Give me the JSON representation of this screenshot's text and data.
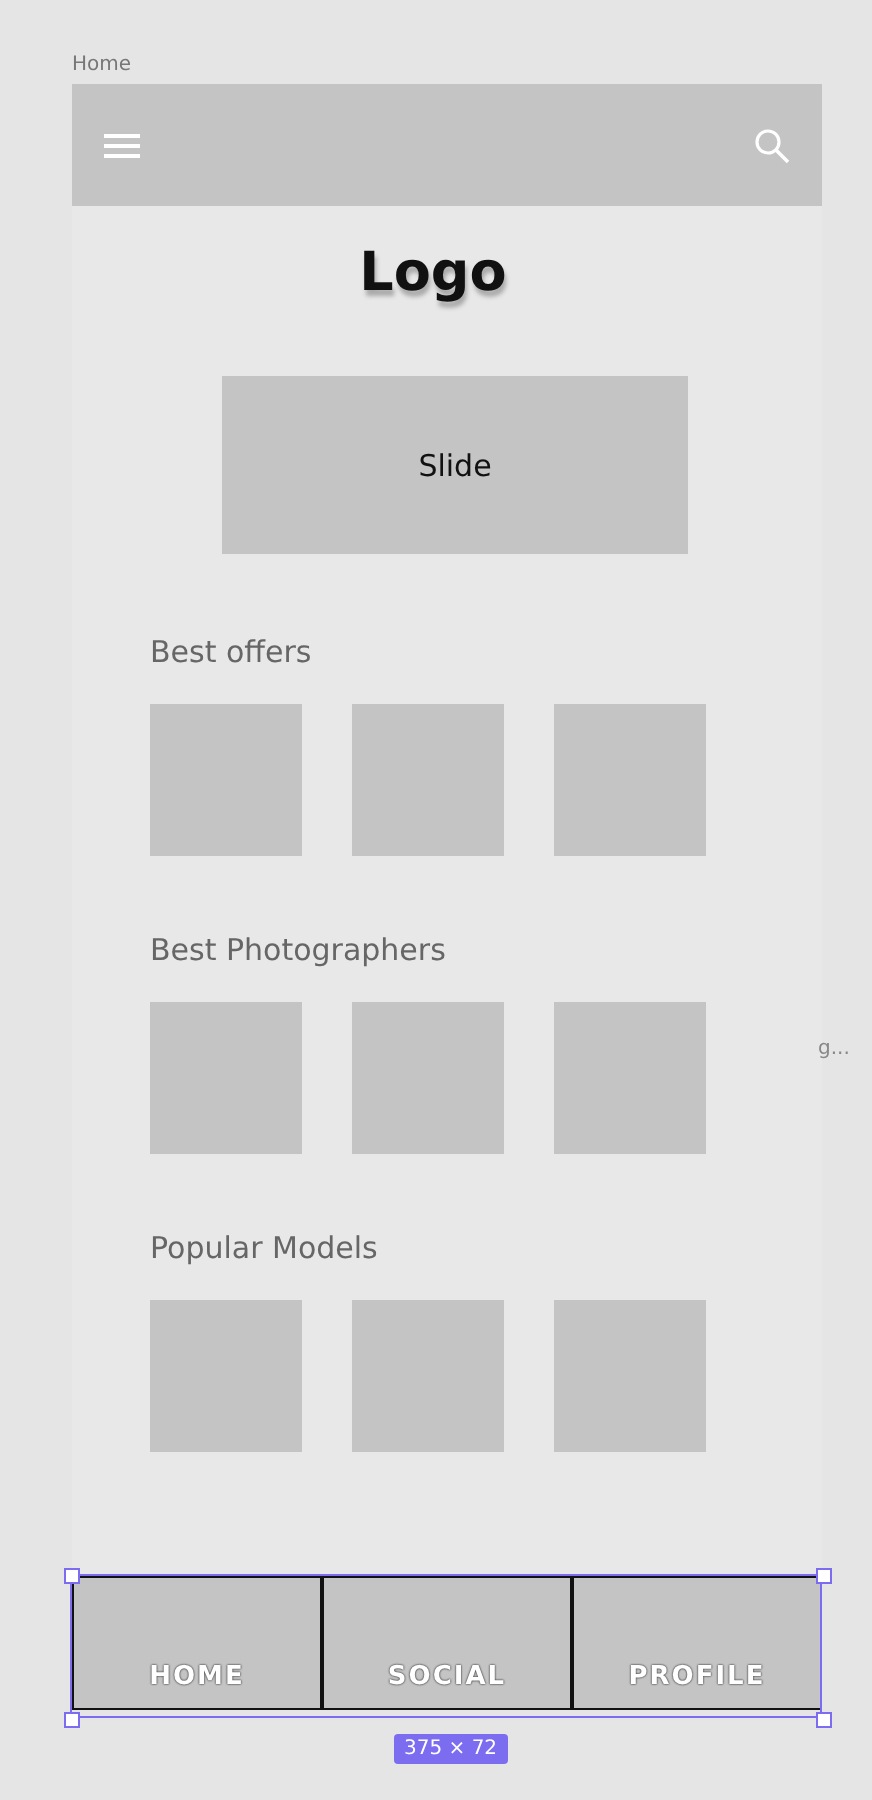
{
  "frame_label": "Home",
  "side_label": "g...",
  "logo": "Logo",
  "slide": "Slide",
  "sections": [
    {
      "title": "Best offers"
    },
    {
      "title": "Best Photographers"
    },
    {
      "title": "Popular Models"
    }
  ],
  "tab_bar": {
    "tabs": [
      {
        "label": "HOME"
      },
      {
        "label": "SOCIAL"
      },
      {
        "label": "PROFILE"
      }
    ],
    "size": "375 × 72"
  }
}
